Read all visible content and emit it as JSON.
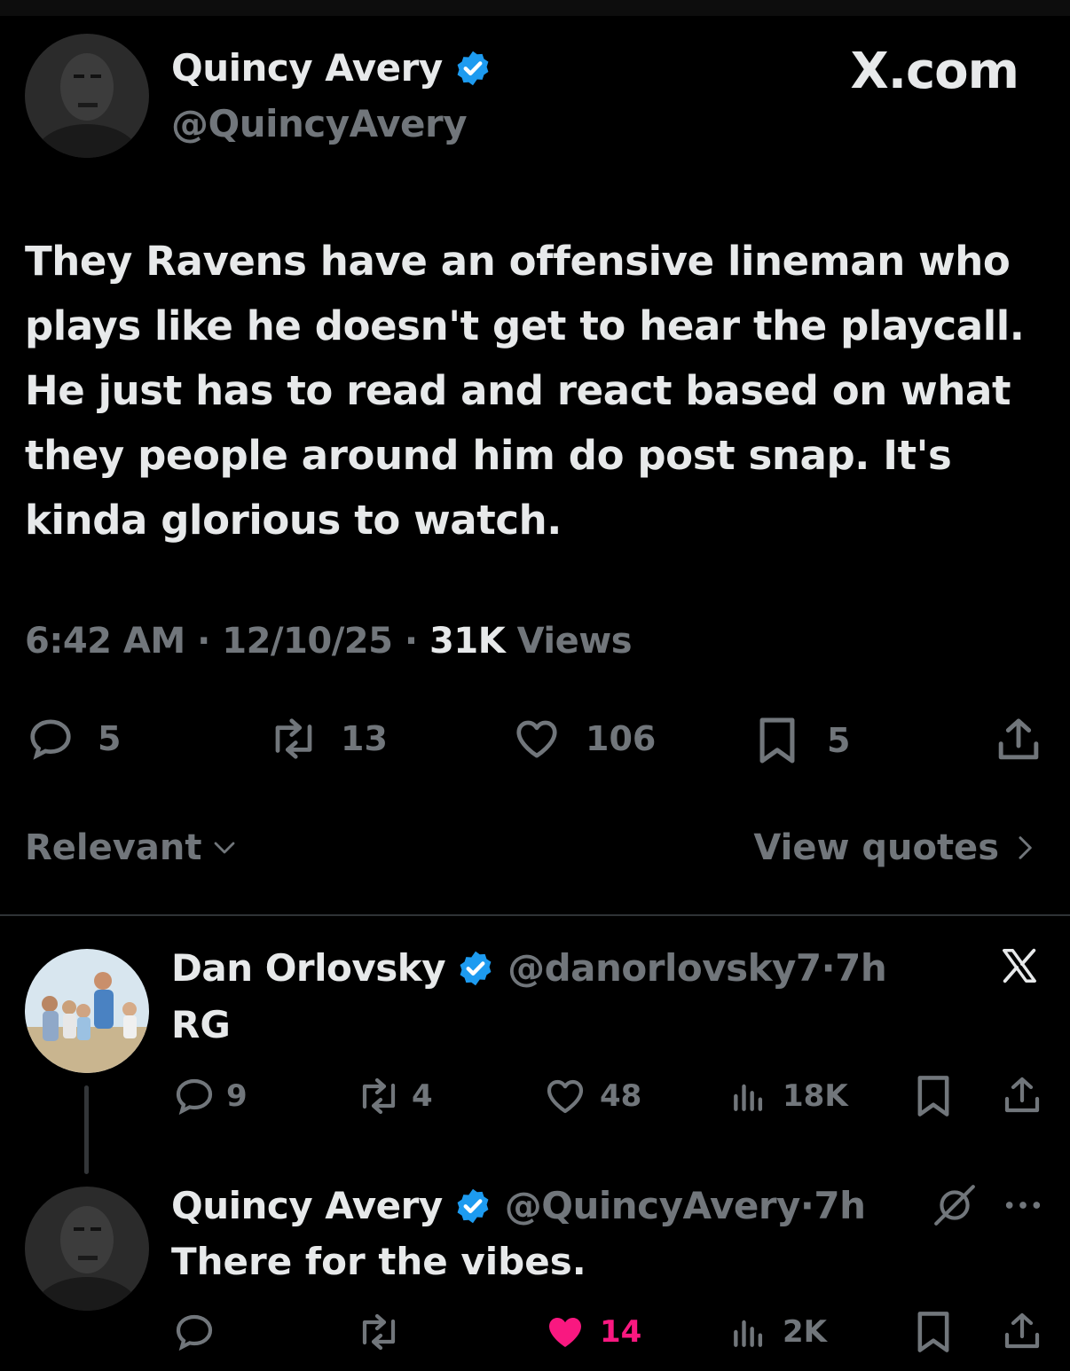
{
  "main_tweet": {
    "author_name": "Quincy Avery",
    "author_handle": "@QuincyAvery",
    "source": "X.com",
    "text": "They Ravens have an offensive lineman who plays like he doesn't get to hear the playcall. He just has to read and react based on what they people around him do post snap. It's kinda glorious to watch.",
    "time": "6:42 AM",
    "date": "12/10/25",
    "views_count": "31K",
    "views_label": "Views",
    "replies": "5",
    "reposts": "13",
    "likes": "106",
    "bookmarks": "5"
  },
  "sort": {
    "label": "Relevant",
    "view_quotes": "View quotes"
  },
  "replies": [
    {
      "author_name": "Dan Orlovsky",
      "author_handle": "@danorlovsky7",
      "age": "7h",
      "text": "RG",
      "replies": "9",
      "reposts": "4",
      "likes": "48",
      "views": "18K"
    },
    {
      "author_name": "Quincy Avery",
      "author_handle": "@QuincyAvery",
      "age": "7h",
      "text": "There for the vibes.",
      "likes": "14",
      "views": "2K",
      "liked": true
    }
  ],
  "colors": {
    "background": "#000000",
    "text": "#e7e9ea",
    "muted": "#71767b",
    "verified": "#1d9bf0",
    "like": "#f91880"
  }
}
